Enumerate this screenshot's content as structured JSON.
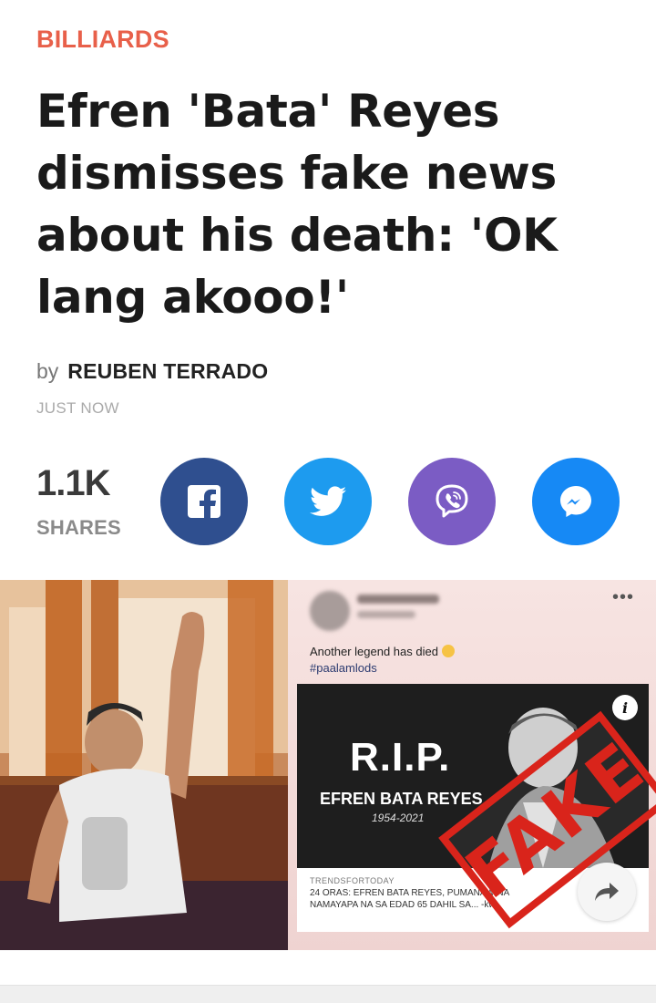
{
  "article": {
    "category": "BILLIARDS",
    "headline": "Efren 'Bata' Reyes dismisses fake news about his death: 'OK lang akooo!'",
    "byline_prefix": "by",
    "author": "REUBEN TERRADO",
    "timestamp": "JUST NOW"
  },
  "shares": {
    "count": "1.1K",
    "label": "SHARES",
    "buttons": [
      {
        "network": "facebook",
        "icon": "facebook-icon",
        "color": "#2f4f8f"
      },
      {
        "network": "twitter",
        "icon": "twitter-icon",
        "color": "#1d9bef"
      },
      {
        "network": "viber",
        "icon": "viber-icon",
        "color": "#7b5cc4"
      },
      {
        "network": "messenger",
        "icon": "messenger-icon",
        "color": "#1689f5"
      }
    ]
  },
  "image": {
    "post_menu": "•••",
    "post_text": "Another legend has died",
    "post_hashtag": "#paalamlods",
    "card_title": "R.I.P.",
    "card_name": "EFREN BATA REYES",
    "card_years": "1954-2021",
    "info_glyph": "i",
    "card_source": "TRENDSFORTODAY",
    "card_caption": "24 ORAS: EFREN BATA REYES, PUMANAW NA",
    "card_caption_2": "NAMAYAPA NA SA EDAD 65 DAHIL SA... -kw",
    "stamp_text": "FAKE",
    "stamp_color": "#d9241b"
  }
}
